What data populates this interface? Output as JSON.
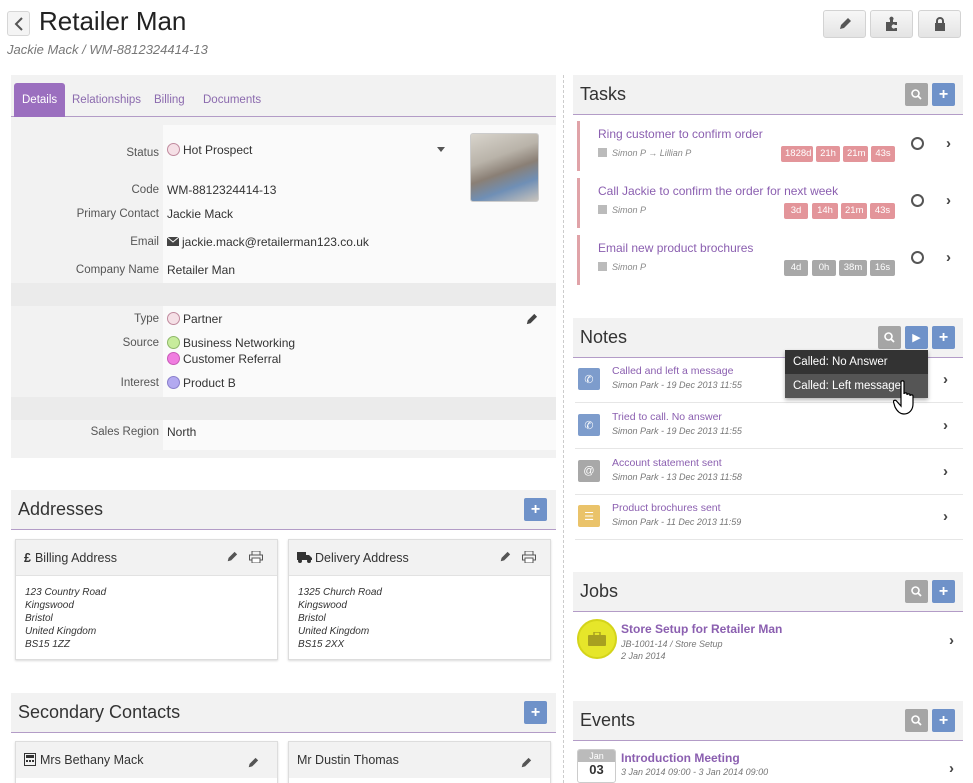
{
  "header": {
    "title": "Retailer Man",
    "subtitle": "Jackie Mack / WM-8812324414-13"
  },
  "tabs": [
    {
      "label": "Details"
    },
    {
      "label": "Relationships"
    },
    {
      "label": "Billing"
    },
    {
      "label": "Documents"
    }
  ],
  "details": {
    "status_label": "Status",
    "status_value": "Hot Prospect",
    "code_label": "Code",
    "code_value": "WM-8812324414-13",
    "primary_contact_label": "Primary Contact",
    "primary_contact_value": "Jackie Mack",
    "email_label": "Email",
    "email_value": "jackie.mack@retailerman123.co.uk",
    "company_label": "Company Name",
    "company_value": "Retailer Man",
    "type_label": "Type",
    "type_value": "Partner",
    "source_label": "Source",
    "source_value_1": "Business Networking",
    "source_value_2": "Customer Referral",
    "interest_label": "Interest",
    "interest_value": "Product B",
    "sales_region_label": "Sales Region",
    "sales_region_value": "North"
  },
  "colors": {
    "accent": "#9b6fbf",
    "type_dot": "#f5e0e6",
    "source_dot_1": "#c7ec9c",
    "source_dot_2": "#f07de0",
    "interest_dot": "#b3a9f0"
  },
  "addresses": {
    "title": "Addresses",
    "billing": {
      "title": "Billing Address",
      "lines": [
        "123 Country Road",
        "Kingswood",
        "Bristol",
        "United Kingdom",
        "BS15 1ZZ"
      ]
    },
    "delivery": {
      "title": "Delivery Address",
      "lines": [
        "1325 Church Road",
        "Kingswood",
        "Bristol",
        "United Kingdom",
        "BS15 2XX"
      ]
    }
  },
  "secondary_contacts": {
    "title": "Secondary Contacts",
    "contact_1": "Mrs Bethany Mack",
    "contact_2": "Mr Dustin Thomas"
  },
  "tasks": {
    "title": "Tasks",
    "items": [
      {
        "title": "Ring customer to confirm order",
        "assignee": "Simon P",
        "assigned_to": "Lillian P",
        "badges": [
          "1828d",
          "21h",
          "21m",
          "43s"
        ]
      },
      {
        "title": "Call Jackie to confirm the order for next week",
        "assignee": "Simon P",
        "badges": [
          "3d",
          "14h",
          "21m",
          "43s"
        ]
      },
      {
        "title": "Email new product brochures",
        "assignee": "Simon P",
        "badges": [
          "4d",
          "0h",
          "38m",
          "16s"
        ]
      }
    ]
  },
  "notes": {
    "title": "Notes",
    "items": [
      {
        "title": "Called and left a message",
        "meta": "Simon Park - 19 Dec 2013 11:55"
      },
      {
        "title": "Tried to call. No answer",
        "meta": "Simon Park - 19 Dec 2013 11:55"
      },
      {
        "title": "Account statement sent",
        "meta": "Simon Park - 13 Dec 2013 11:58"
      },
      {
        "title": "Product brochures sent",
        "meta": "Simon Park - 11 Dec 2013 11:59"
      }
    ],
    "menu": [
      "Called: No Answer",
      "Called: Left message"
    ]
  },
  "jobs": {
    "title": "Jobs",
    "item": {
      "title": "Store Setup for Retailer Man",
      "ref": "JB-1001-14 / Store Setup",
      "date": "2 Jan 2014"
    }
  },
  "events": {
    "title": "Events",
    "item": {
      "month": "Jan",
      "day": "03",
      "title": "Introduction Meeting",
      "time": "3 Jan 2014 09:00 - 3 Jan 2014 09:00"
    }
  }
}
